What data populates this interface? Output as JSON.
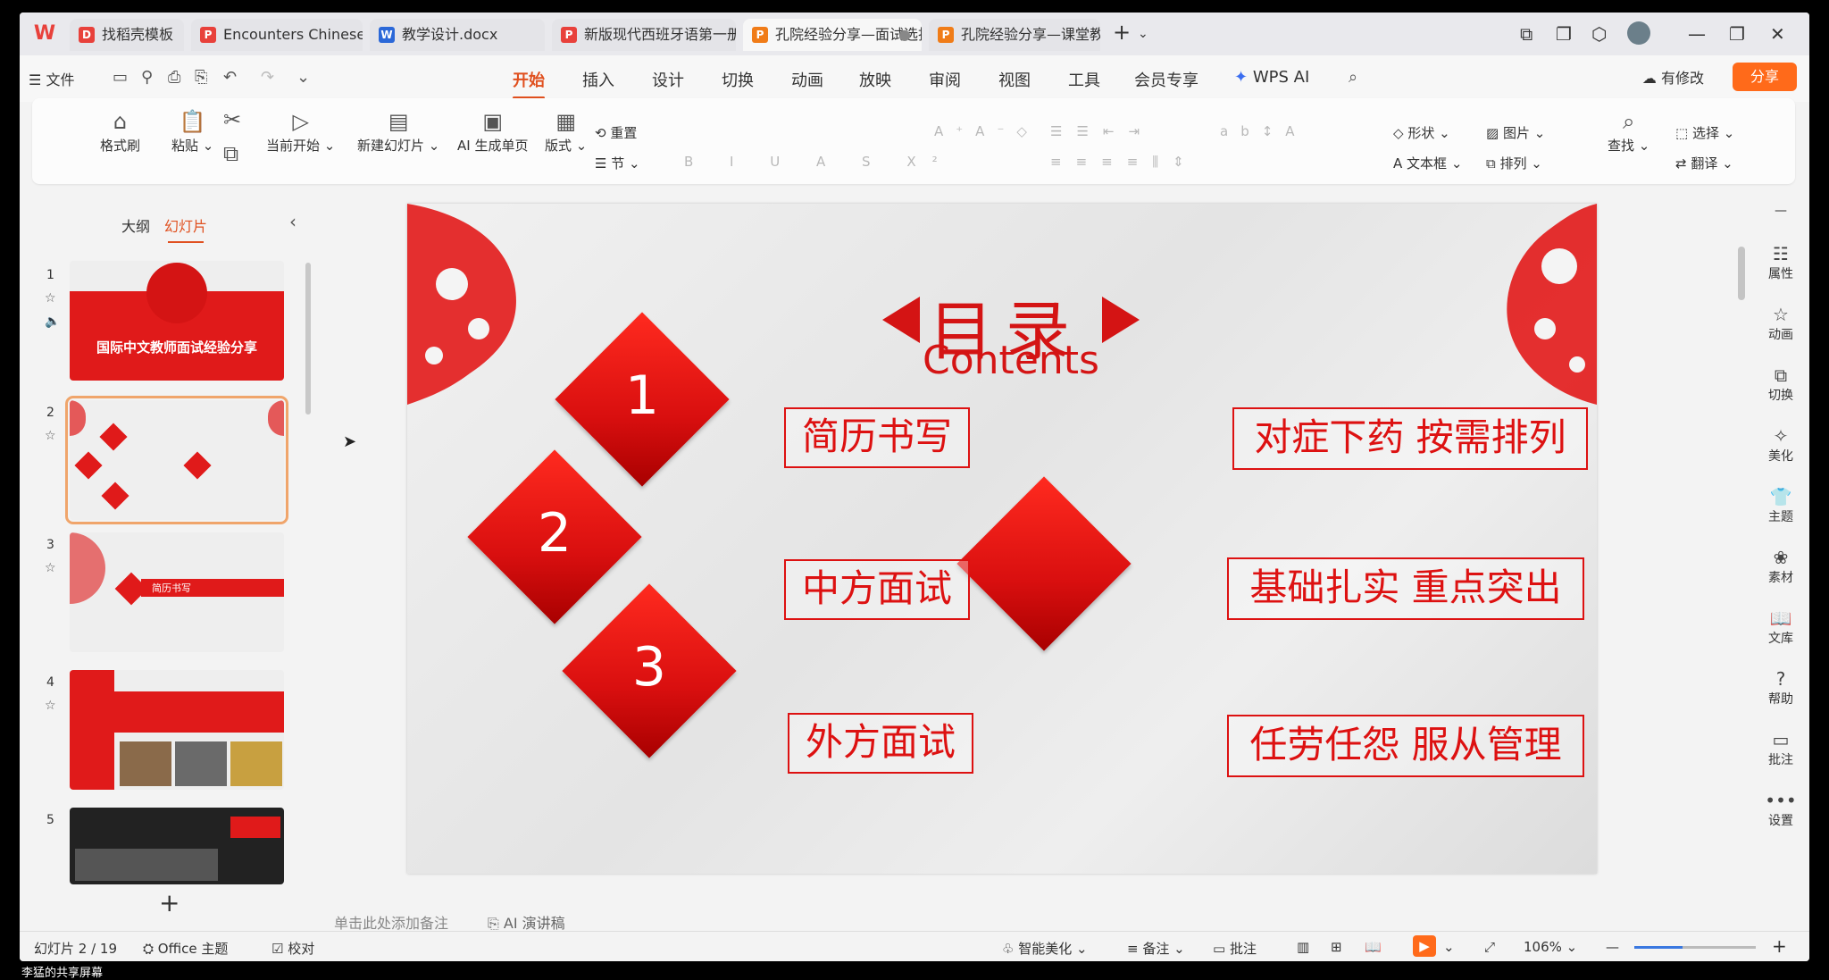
{
  "tabs": [
    {
      "label": "找稻壳模板",
      "icon": "docer-icon",
      "color": "#e8413b"
    },
    {
      "label": "Encounters Chinese Langua",
      "icon": "pdf-icon",
      "color": "#e8413b"
    },
    {
      "label": "教学设计.docx",
      "icon": "word-icon",
      "color": "#2b68d8"
    },
    {
      "label": "新版现代西班牙语第一册.pdf",
      "icon": "pdf-icon",
      "color": "#e8413b"
    },
    {
      "label": "孔院经验分享—面试选拔",
      "icon": "ppt-icon",
      "color": "#f07c18"
    },
    {
      "label": "孔院经验分享—课堂教学篇-",
      "icon": "ppt-icon",
      "color": "#f07c18"
    }
  ],
  "menubar": {
    "file": "文件",
    "tabs": [
      "开始",
      "插入",
      "设计",
      "切换",
      "动画",
      "放映",
      "审阅",
      "视图",
      "工具",
      "会员专享"
    ],
    "wps_ai": "WPS AI",
    "modified": "有修改",
    "share": "分享"
  },
  "ribbon": {
    "format_painter": "格式刷",
    "paste": "粘贴",
    "play_from_current": "当前开始",
    "new_slide": "新建幻灯片",
    "ai_single": "AI 生成单页",
    "layout": "版式",
    "reset": "重置",
    "section": "节",
    "shape": "形状",
    "picture": "图片",
    "select": "选择",
    "textbox": "文本框",
    "arrange": "排列",
    "find": "查找",
    "translate": "翻译"
  },
  "left_panel": {
    "outline": "大纲",
    "slides": "幻灯片",
    "thumbs": [
      {
        "num": "1",
        "title": "国际中文教师面试经验分享"
      },
      {
        "num": "2"
      },
      {
        "num": "3",
        "title": "简历书写"
      },
      {
        "num": "4"
      },
      {
        "num": "5"
      }
    ]
  },
  "slide": {
    "title": "目录",
    "subtitle": "Contents",
    "numbers": [
      "1",
      "2",
      "3"
    ],
    "left_labels": [
      "简历书写",
      "中方面试",
      "外方面试"
    ],
    "right_labels": [
      "对症下药 按需排列",
      "基础扎实 重点突出",
      "任劳任怨 服从管理"
    ]
  },
  "right_sidebar": [
    "属性",
    "动画",
    "切换",
    "美化",
    "主题",
    "素材",
    "文库",
    "帮助",
    "批注",
    "设置"
  ],
  "notes": {
    "placeholder": "单击此处添加备注",
    "ai_script": "AI 演讲稿"
  },
  "status": {
    "slide_counter": "幻灯片 2 / 19",
    "theme": "Office 主题",
    "proof": "校对",
    "smart_beautify": "智能美化",
    "notes": "备注",
    "comments": "批注",
    "zoom": "106%",
    "zoom_level": 0.4
  },
  "caption": "李猛的共享屏幕"
}
